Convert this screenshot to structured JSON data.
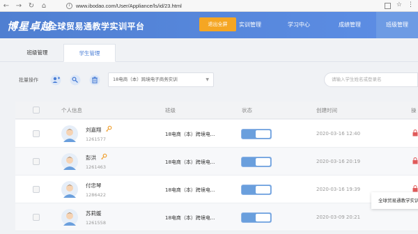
{
  "browser": {
    "url": "www.ibodao.com/User/Appliance/ls/id/23.html",
    "back_icon": "←",
    "forward_icon": "→",
    "reload_icon": "↻",
    "home_icon": "⌂",
    "star_icon": "☆",
    "more_icon": "⋮"
  },
  "header": {
    "logo": "博星卓越",
    "title": "全球贸易通教学实训平台",
    "exit_button": "退出全屏",
    "nav": [
      {
        "label": "实训管理"
      },
      {
        "label": "学习中心"
      },
      {
        "label": "成绩管理"
      },
      {
        "label": "班级管理"
      }
    ]
  },
  "tabs": [
    {
      "label": "班级管理"
    },
    {
      "label": "学生管理"
    }
  ],
  "toolbar": {
    "batch_label": "批量操作",
    "class_select": "18电商（本）跨境电子商务实训",
    "search_placeholder": "请输入学生姓名或登录名"
  },
  "table": {
    "headers": [
      "个人信息",
      "班级",
      "状态",
      "创建时间",
      "操"
    ],
    "rows": [
      {
        "name": "刘嘉翔",
        "id": "1261577",
        "class": "18电商（本）跨境电...",
        "created": "2020-03-16 12:40",
        "has_key": true
      },
      {
        "name": "彭洪",
        "id": "1261463",
        "class": "18电商（本）跨境电...",
        "created": "2020-03-16 20:19",
        "has_key": true
      },
      {
        "name": "付忠琴",
        "id": "1286422",
        "class": "18电商（本）跨境电...",
        "created": "2020-03-16 19:39",
        "has_key": false
      },
      {
        "name": "苏莉媛",
        "id": "1261558",
        "class": "18电商（本）跨境电...",
        "created": "2020-03-09 20:21",
        "has_key": false
      }
    ]
  },
  "tooltip": "全球贸易通教学实训",
  "colors": {
    "header": "#5a89dc",
    "accent": "#4a7ed6",
    "exit": "#f5a623",
    "toggle": "#6a9fdd",
    "lock": "#e05a5a",
    "key": "#f0a030"
  }
}
